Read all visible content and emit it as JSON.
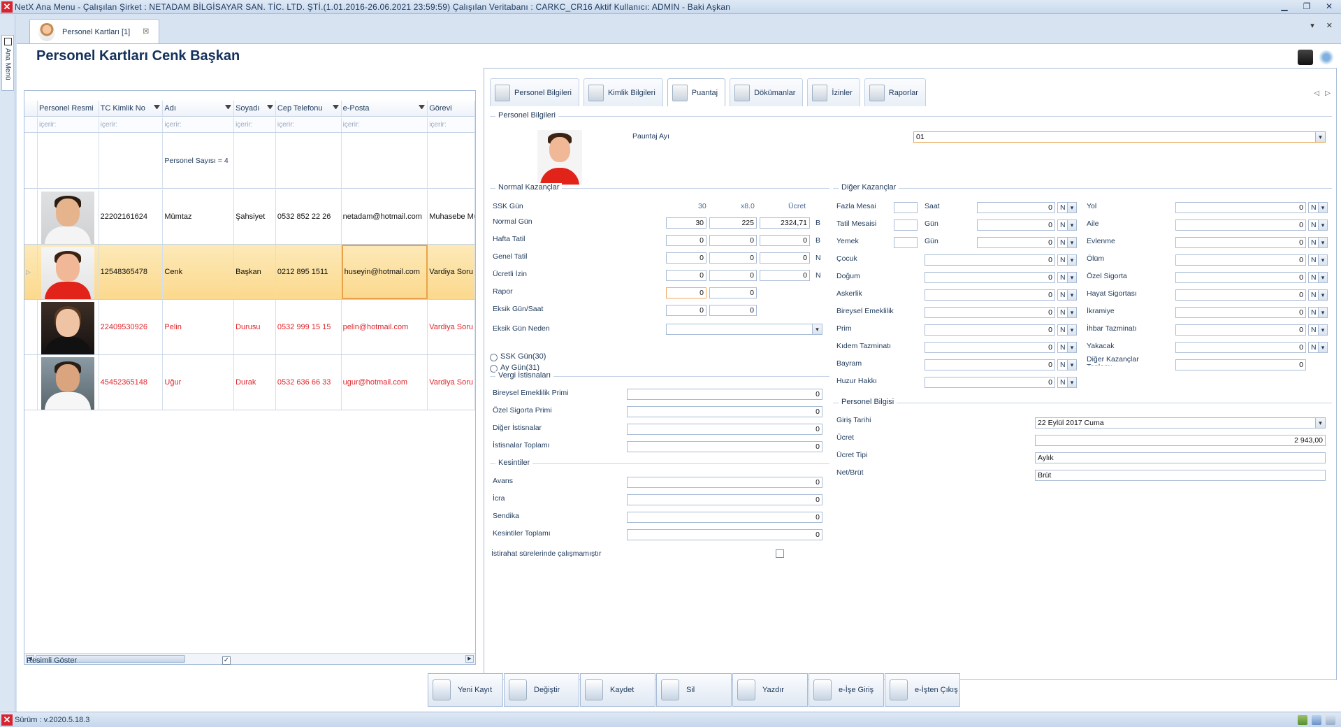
{
  "window": {
    "title": "NetX Ana Menu - Çalışılan Şirket : NETADAM BİLGİSAYAR SAN. TİC. LTD. ŞTİ.(1.01.2016-26.06.2021 23:59:59) Çalışılan Veritabanı : CARKC_CR16  Aktif Kullanıcı: ADMIN - Baki Aşkan",
    "side_menu_label": "Ana Menü",
    "doc_tab_label": "Personel Kartları [1]",
    "doc_tab_close": "☒"
  },
  "page": {
    "title": "Personel Kartları Cenk Başkan"
  },
  "grid": {
    "columns": [
      "Personel Resmi",
      "TC Kimlik No",
      "Adı",
      "Soyadı",
      "Cep Telefonu",
      "e-Posta",
      "Görevi"
    ],
    "filter_placeholder": "içerir:",
    "summary": "Personel Sayısı = 4",
    "rows": [
      {
        "tc": "22202161624",
        "ad": "Mümtaz",
        "soyad": "Şahsiyet",
        "tel": "0532 852 22 26",
        "mail": "netadam@hotmail.com",
        "gorev": "Muhasebe Mü"
      },
      {
        "tc": "12548365478",
        "ad": "Cenk",
        "soyad": "Başkan",
        "tel": "0212 895 1511",
        "mail": "huseyin@hotmail.com",
        "gorev": "Vardiya Soru"
      },
      {
        "tc": "22409530926",
        "ad": "Pelin",
        "soyad": "Durusu",
        "tel": "0532 999 15 15",
        "mail": "pelin@hotmail.com",
        "gorev": "Vardiya Soru"
      },
      {
        "tc": "45452365148",
        "ad": "Uğur",
        "soyad": "Durak",
        "tel": "0532 636 66 33",
        "mail": "ugur@hotmail.com",
        "gorev": "Vardiya Soru"
      }
    ],
    "selected_row_indicator": "▷",
    "show_photos_label": "Resimli Göster",
    "show_photos_checked": "✓"
  },
  "tabs": [
    "Personel Bilgileri",
    "Kimlik Bilgileri",
    "Puantaj",
    "Dökümanlar",
    "İzinler",
    "Raporlar"
  ],
  "active_tab": "Puantaj",
  "personel_bilgileri": {
    "group": "Personel Bilgileri",
    "puantaj_ayi_label": "Pauntaj Ayı",
    "puantaj_ayi": "01"
  },
  "normal": {
    "group": "Normal Kazançlar",
    "head": {
      "label": "SSK Gün",
      "c1": "30",
      "c2": "x8.0",
      "c3": "Ücret"
    },
    "rows": [
      {
        "label": "Normal Gün",
        "v1": "30",
        "v2": "225",
        "v3": "2324,71",
        "s": "B"
      },
      {
        "label": "Hafta Tatil",
        "v1": "0",
        "v2": "0",
        "v3": "0",
        "s": "B"
      },
      {
        "label": "Genel Tatil",
        "v1": "0",
        "v2": "0",
        "v3": "0",
        "s": "N"
      },
      {
        "label": "Ücretli İzin",
        "v1": "0",
        "v2": "0",
        "v3": "0",
        "s": "N"
      },
      {
        "label": "Rapor",
        "v1": "0",
        "v2": "0"
      },
      {
        "label": "Eksik Gün/Saat",
        "v1": "0",
        "v2": "0"
      }
    ],
    "eksik_neden_label": "Eksik Gün Neden",
    "radio1": "SSK Gün(30)",
    "radio2": "Ay Gün(31)"
  },
  "vergi": {
    "group": "Vergi İstisnaları",
    "rows": [
      {
        "label": "Bireysel Emeklilik Primi",
        "v": "0"
      },
      {
        "label": "Özel Sigorta Primi",
        "v": "0"
      },
      {
        "label": "Diğer İstisnalar",
        "v": "0"
      },
      {
        "label": "İstisnalar Toplamı",
        "v": "0"
      }
    ]
  },
  "kesintiler": {
    "group": "Kesintiler",
    "rows": [
      {
        "label": "Avans",
        "v": "0"
      },
      {
        "label": "İcra",
        "v": "0"
      },
      {
        "label": "Sendika",
        "v": "0"
      },
      {
        "label": "Kesintiler Toplamı",
        "v": "0"
      }
    ],
    "istirahat_label": "İstirahat sürelerinde çalışmamıştır"
  },
  "diger": {
    "group": "Diğer Kazançlar",
    "left": [
      {
        "label": "Fazla Mesai",
        "unit": "Saat",
        "v": "0",
        "n": "N"
      },
      {
        "label": "Tatil Mesaisi",
        "unit": "Gün",
        "v": "0",
        "n": "N"
      },
      {
        "label": "Yemek",
        "unit": "Gün",
        "v": "0",
        "n": "N"
      },
      {
        "label": "Çocuk",
        "v": "0",
        "n": "N"
      },
      {
        "label": "Doğum",
        "v": "0",
        "n": "N"
      },
      {
        "label": "Askerlik",
        "v": "0",
        "n": "N"
      },
      {
        "label": "Bireysel Emeklilik",
        "v": "0",
        "n": "N"
      },
      {
        "label": "Prim",
        "v": "0",
        "n": "N"
      },
      {
        "label": "Kıdem Tazminatı",
        "v": "0",
        "n": "N"
      },
      {
        "label": "Bayram",
        "v": "0",
        "n": "N"
      },
      {
        "label": "Huzur Hakkı",
        "v": "0",
        "n": "N"
      }
    ],
    "right": [
      {
        "label": "Yol",
        "v": "0",
        "n": "N"
      },
      {
        "label": "Aile",
        "v": "0",
        "n": "N"
      },
      {
        "label": "Evlenme",
        "v": "0",
        "n": "N"
      },
      {
        "label": "Ölüm",
        "v": "0",
        "n": "N"
      },
      {
        "label": "Özel Sigorta",
        "v": "0",
        "n": "N"
      },
      {
        "label": "Hayat Sigortası",
        "v": "0",
        "n": "N"
      },
      {
        "label": "İkramiye",
        "v": "0",
        "n": "N"
      },
      {
        "label": "İhbar Tazminatı",
        "v": "0",
        "n": "N"
      },
      {
        "label": "Yakacak",
        "v": "0",
        "n": "N"
      },
      {
        "label": "Diğer Kazançlar Toplamı",
        "v": "0"
      }
    ]
  },
  "personel_bilgisi": {
    "group": "Personel Bilgisi",
    "giris_label": "Giriş Tarihi",
    "giris": "22 Eylül 2017 Cuma",
    "ucret_label": "Ücret",
    "ucret": "2 943,00",
    "tip_label": "Ücret Tipi",
    "tip": "Aylık",
    "net_label": "Net/Brüt",
    "net": "Brüt"
  },
  "buttons": [
    "Yeni Kayıt",
    "Değiştir",
    "Kaydet",
    "Sil",
    "Yazdır",
    "e-İşe Giriş",
    "e-İşten Çıkış"
  ],
  "status": {
    "version": "Sürüm : v.2020.5.18.3"
  },
  "colors": {
    "accent": "#15325c",
    "selected_row": "#fbd98d",
    "red_text": "#e0262c"
  }
}
